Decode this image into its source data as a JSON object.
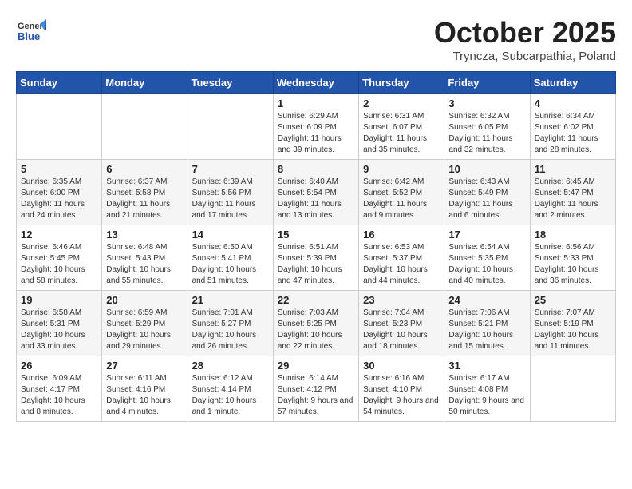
{
  "header": {
    "logo_general": "General",
    "logo_blue": "Blue",
    "month": "October 2025",
    "location": "Tryncza, Subcarpathia, Poland"
  },
  "days_of_week": [
    "Sunday",
    "Monday",
    "Tuesday",
    "Wednesday",
    "Thursday",
    "Friday",
    "Saturday"
  ],
  "weeks": [
    [
      {
        "day": "",
        "info": ""
      },
      {
        "day": "",
        "info": ""
      },
      {
        "day": "",
        "info": ""
      },
      {
        "day": "1",
        "info": "Sunrise: 6:29 AM\nSunset: 6:09 PM\nDaylight: 11 hours and 39 minutes."
      },
      {
        "day": "2",
        "info": "Sunrise: 6:31 AM\nSunset: 6:07 PM\nDaylight: 11 hours and 35 minutes."
      },
      {
        "day": "3",
        "info": "Sunrise: 6:32 AM\nSunset: 6:05 PM\nDaylight: 11 hours and 32 minutes."
      },
      {
        "day": "4",
        "info": "Sunrise: 6:34 AM\nSunset: 6:02 PM\nDaylight: 11 hours and 28 minutes."
      }
    ],
    [
      {
        "day": "5",
        "info": "Sunrise: 6:35 AM\nSunset: 6:00 PM\nDaylight: 11 hours and 24 minutes."
      },
      {
        "day": "6",
        "info": "Sunrise: 6:37 AM\nSunset: 5:58 PM\nDaylight: 11 hours and 21 minutes."
      },
      {
        "day": "7",
        "info": "Sunrise: 6:39 AM\nSunset: 5:56 PM\nDaylight: 11 hours and 17 minutes."
      },
      {
        "day": "8",
        "info": "Sunrise: 6:40 AM\nSunset: 5:54 PM\nDaylight: 11 hours and 13 minutes."
      },
      {
        "day": "9",
        "info": "Sunrise: 6:42 AM\nSunset: 5:52 PM\nDaylight: 11 hours and 9 minutes."
      },
      {
        "day": "10",
        "info": "Sunrise: 6:43 AM\nSunset: 5:49 PM\nDaylight: 11 hours and 6 minutes."
      },
      {
        "day": "11",
        "info": "Sunrise: 6:45 AM\nSunset: 5:47 PM\nDaylight: 11 hours and 2 minutes."
      }
    ],
    [
      {
        "day": "12",
        "info": "Sunrise: 6:46 AM\nSunset: 5:45 PM\nDaylight: 10 hours and 58 minutes."
      },
      {
        "day": "13",
        "info": "Sunrise: 6:48 AM\nSunset: 5:43 PM\nDaylight: 10 hours and 55 minutes."
      },
      {
        "day": "14",
        "info": "Sunrise: 6:50 AM\nSunset: 5:41 PM\nDaylight: 10 hours and 51 minutes."
      },
      {
        "day": "15",
        "info": "Sunrise: 6:51 AM\nSunset: 5:39 PM\nDaylight: 10 hours and 47 minutes."
      },
      {
        "day": "16",
        "info": "Sunrise: 6:53 AM\nSunset: 5:37 PM\nDaylight: 10 hours and 44 minutes."
      },
      {
        "day": "17",
        "info": "Sunrise: 6:54 AM\nSunset: 5:35 PM\nDaylight: 10 hours and 40 minutes."
      },
      {
        "day": "18",
        "info": "Sunrise: 6:56 AM\nSunset: 5:33 PM\nDaylight: 10 hours and 36 minutes."
      }
    ],
    [
      {
        "day": "19",
        "info": "Sunrise: 6:58 AM\nSunset: 5:31 PM\nDaylight: 10 hours and 33 minutes."
      },
      {
        "day": "20",
        "info": "Sunrise: 6:59 AM\nSunset: 5:29 PM\nDaylight: 10 hours and 29 minutes."
      },
      {
        "day": "21",
        "info": "Sunrise: 7:01 AM\nSunset: 5:27 PM\nDaylight: 10 hours and 26 minutes."
      },
      {
        "day": "22",
        "info": "Sunrise: 7:03 AM\nSunset: 5:25 PM\nDaylight: 10 hours and 22 minutes."
      },
      {
        "day": "23",
        "info": "Sunrise: 7:04 AM\nSunset: 5:23 PM\nDaylight: 10 hours and 18 minutes."
      },
      {
        "day": "24",
        "info": "Sunrise: 7:06 AM\nSunset: 5:21 PM\nDaylight: 10 hours and 15 minutes."
      },
      {
        "day": "25",
        "info": "Sunrise: 7:07 AM\nSunset: 5:19 PM\nDaylight: 10 hours and 11 minutes."
      }
    ],
    [
      {
        "day": "26",
        "info": "Sunrise: 6:09 AM\nSunset: 4:17 PM\nDaylight: 10 hours and 8 minutes."
      },
      {
        "day": "27",
        "info": "Sunrise: 6:11 AM\nSunset: 4:16 PM\nDaylight: 10 hours and 4 minutes."
      },
      {
        "day": "28",
        "info": "Sunrise: 6:12 AM\nSunset: 4:14 PM\nDaylight: 10 hours and 1 minute."
      },
      {
        "day": "29",
        "info": "Sunrise: 6:14 AM\nSunset: 4:12 PM\nDaylight: 9 hours and 57 minutes."
      },
      {
        "day": "30",
        "info": "Sunrise: 6:16 AM\nSunset: 4:10 PM\nDaylight: 9 hours and 54 minutes."
      },
      {
        "day": "31",
        "info": "Sunrise: 6:17 AM\nSunset: 4:08 PM\nDaylight: 9 hours and 50 minutes."
      },
      {
        "day": "",
        "info": ""
      }
    ]
  ]
}
